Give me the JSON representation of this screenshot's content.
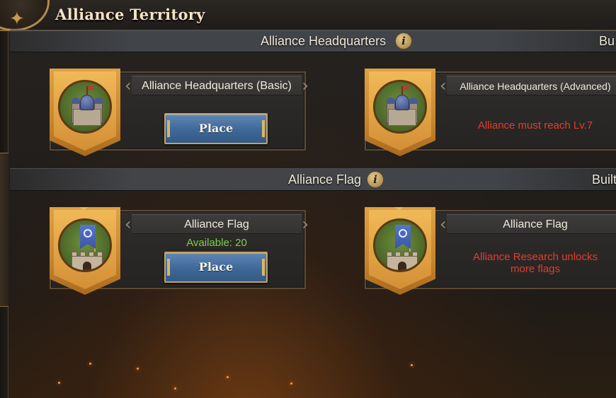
{
  "window": {
    "title": "Alliance Territory"
  },
  "sections": [
    {
      "title": "Alliance Headquarters",
      "built_label": "Bu",
      "items": [
        {
          "name": "Alliance Headquarters (Basic)",
          "action": "Place",
          "icon": "castle-icon"
        },
        {
          "name": "Alliance Headquarters (Advanced)",
          "requirement": "Alliance must reach Lv.7",
          "icon": "castle-icon"
        }
      ]
    },
    {
      "title": "Alliance Flag",
      "built_label": "Built",
      "items": [
        {
          "name": "Alliance Flag",
          "available": "Available: 20",
          "action": "Place",
          "icon": "flag-fort-icon"
        },
        {
          "name": "Alliance Flag",
          "requirement": "Alliance Research unlocks more flags",
          "icon": "flag-fort-icon"
        }
      ]
    }
  ],
  "colors": {
    "accent_gold": "#c7a35d",
    "button_blue": "#3f6898",
    "available_green": "#7bd04a",
    "requirement_red": "#e23c2e"
  }
}
